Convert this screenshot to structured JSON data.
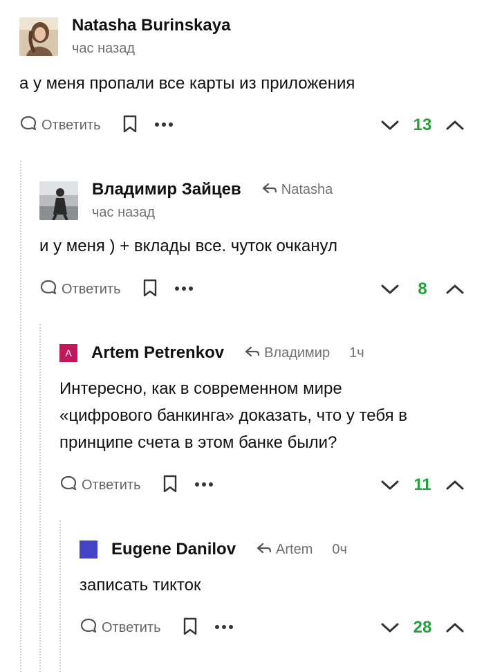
{
  "comments": [
    {
      "author": "Natasha Burinskaya",
      "time": "час назад",
      "reply_to": "",
      "text": [
        "а у меня пропали все карты из приложения"
      ],
      "reply_label": "Ответить",
      "score": "13",
      "avatar": "photo"
    },
    {
      "author": "Владимир Зайцев",
      "time": "час назад",
      "reply_to": "Natasha",
      "text": [
        "и у меня ) + вклады все. чуток очканул"
      ],
      "reply_label": "Ответить",
      "score": "8",
      "avatar": "photo"
    },
    {
      "author": "Artem Petrenkov",
      "time": "1ч",
      "reply_to": "Владимир",
      "avatar_letter": "A",
      "avatar_color": "#c2185b",
      "text": [
        "Интересно, как в современном мире",
        "«цифрового банкинга» доказать, что у тебя в",
        "принципе счета в этом банке были?"
      ],
      "reply_label": "Ответить",
      "score": "11"
    },
    {
      "author": "Eugene Danilov",
      "time": "0ч",
      "reply_to": "Artem",
      "avatar_color": "#4444c8",
      "text": [
        "записать тикток"
      ],
      "reply_label": "Ответить",
      "score": "28"
    }
  ],
  "colors": {
    "score": "#22a33a",
    "muted": "#707070",
    "thread_line": "#cfcfcf"
  },
  "icons": [
    "speech-bubble-icon",
    "bookmark-icon",
    "more-dots-icon",
    "chevron-down-icon",
    "chevron-up-icon",
    "reply-arrow-icon"
  ]
}
